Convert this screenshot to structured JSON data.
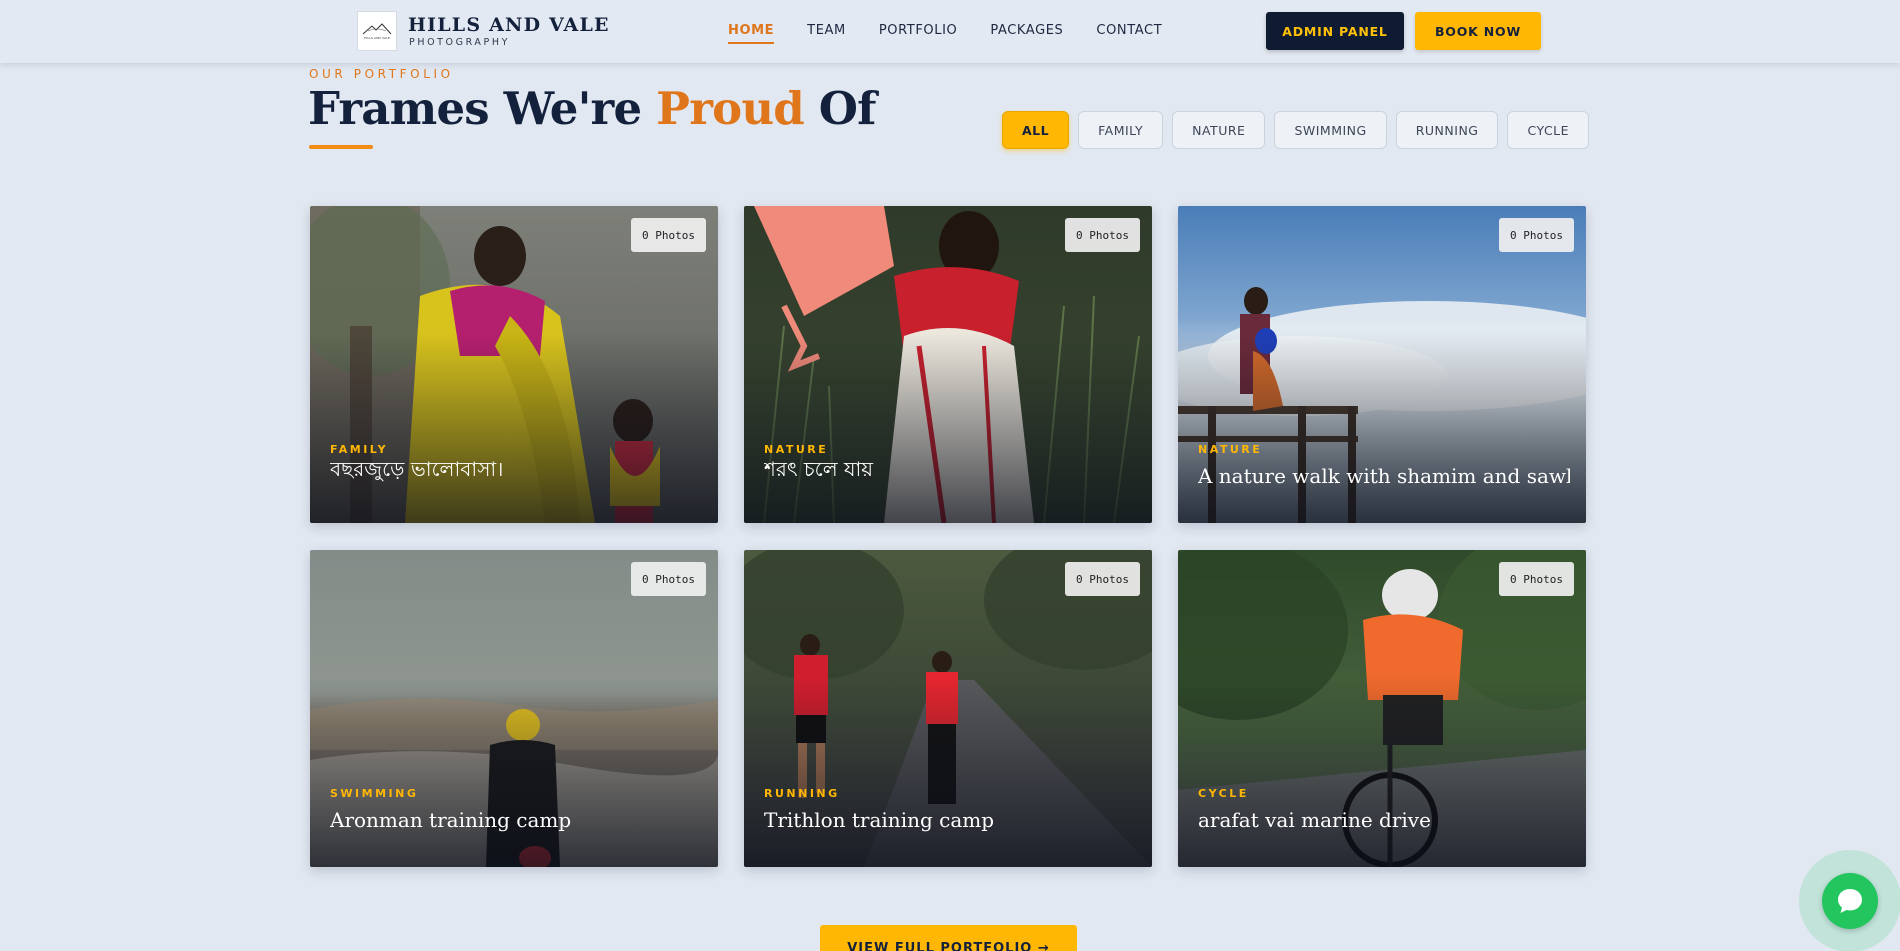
{
  "header": {
    "logo_text": "HILLS AND VALE",
    "brand_name": "HILLS AND VALE",
    "brand_sub": "PHOTOGRAPHY",
    "nav": [
      "HOME",
      "TEAM",
      "PORTFOLIO",
      "PACKAGES",
      "CONTACT"
    ],
    "active_nav": "HOME",
    "admin_label": "ADMIN PANEL",
    "book_label": "BOOK NOW"
  },
  "section": {
    "eyebrow": "OUR PORTFOLIO",
    "title_pre": "Frames We're ",
    "title_accent": "Proud",
    "title_post": " Of"
  },
  "filters": [
    "ALL",
    "FAMILY",
    "NATURE",
    "SWIMMING",
    "RUNNING",
    "CYCLE"
  ],
  "active_filter": "ALL",
  "cards": [
    {
      "badge": "0 Photos",
      "category": "FAMILY",
      "title": "বছরজুড়ে ভালোবাসা।"
    },
    {
      "badge": "0 Photos",
      "category": "NATURE",
      "title": "শরৎ চলে যায়"
    },
    {
      "badge": "0 Photos",
      "category": "NATURE",
      "title": "A nature walk with shamim and sawlin"
    },
    {
      "badge": "0 Photos",
      "category": "SWIMMING",
      "title": "Aronman training camp"
    },
    {
      "badge": "0 Photos",
      "category": "RUNNING",
      "title": "Trithlon training camp"
    },
    {
      "badge": "0 Photos",
      "category": "CYCLE",
      "title": "arafat vai marine drive"
    }
  ],
  "cta_label": "VIEW FULL PORTFOLIO →",
  "colors": {
    "accent": "#e0761b",
    "primary_button": "#ffb703",
    "dark": "#0f1b33",
    "chat": "#22c55e"
  },
  "icons": {
    "chat": "chat-bubble-icon",
    "logo": "mountain-logo-icon"
  }
}
